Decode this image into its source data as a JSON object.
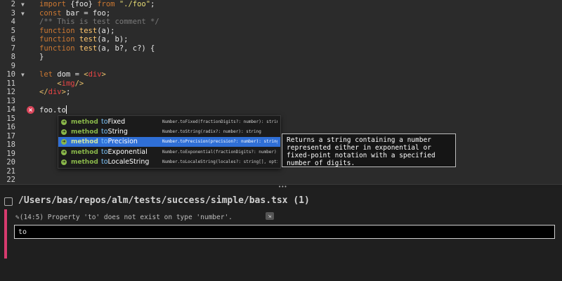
{
  "editor": {
    "lines": [
      {
        "num": "2",
        "html": "<span class='kw'>import</span> {foo} <span class='kw'>from</span> <span class='str'>\"./foo\"</span>;"
      },
      {
        "num": "3",
        "html": "<span class='kw'>const</span> bar = foo;"
      },
      {
        "num": "4",
        "html": "<span class='cmt'>/** This is test comment */</span>"
      },
      {
        "num": "5",
        "html": "<span class='kw'>function</span> <span class='fn'>test</span>(a);"
      },
      {
        "num": "6",
        "html": "<span class='kw'>function</span> <span class='fn'>test</span>(a, b);"
      },
      {
        "num": "7",
        "html": "<span class='kw'>function</span> <span class='fn'>test</span>(a, b?, c?) {"
      },
      {
        "num": "8",
        "html": "}"
      },
      {
        "num": "9",
        "html": ""
      },
      {
        "num": "10",
        "html": "<span class='kw'>let</span> dom = <span class='tag'>&lt;</span><span class='tagname'>div</span><span class='tag'>&gt;</span>"
      },
      {
        "num": "11",
        "html": "    <span class='tag'>&lt;</span><span class='tagname'>img</span><span class='tag'>/&gt;</span>"
      },
      {
        "num": "12",
        "html": "<span class='tag'>&lt;/</span><span class='tagname'>div</span><span class='tag'>&gt;</span>;"
      },
      {
        "num": "13",
        "html": ""
      },
      {
        "num": "14",
        "html": "foo.to<span class='caret'></span>"
      },
      {
        "num": "15",
        "html": ""
      },
      {
        "num": "16",
        "html": ""
      },
      {
        "num": "17",
        "html": ""
      },
      {
        "num": "18",
        "html": ""
      },
      {
        "num": "19",
        "html": ""
      },
      {
        "num": "20",
        "html": ""
      },
      {
        "num": "21",
        "html": ""
      },
      {
        "num": "22",
        "html": ""
      }
    ],
    "fold_lines": [
      "2",
      "3",
      "10"
    ],
    "error_line": "14"
  },
  "autocomplete": {
    "items": [
      {
        "kind": "method",
        "name_match": "to",
        "name_rest": "Fixed",
        "signature": "Number.toFixed(fractionDigits?: number): string",
        "selected": false
      },
      {
        "kind": "method",
        "name_match": "to",
        "name_rest": "String",
        "signature": "Number.toString(radix?: number): string",
        "selected": false
      },
      {
        "kind": "method",
        "name_match": "to",
        "name_rest": "Precision",
        "signature": "Number.toPrecision(precision?: number): string",
        "selected": true
      },
      {
        "kind": "method",
        "name_match": "to",
        "name_rest": "Exponential",
        "signature": "Number.toExponential(fractionDigits?: number): string",
        "selected": false
      },
      {
        "kind": "method",
        "name_match": "to",
        "name_rest": "LocaleString",
        "signature": "Number.toLocaleString(locales?: string[], options?: any): string",
        "selected": false
      }
    ],
    "doc": "Returns a string containing a number represented either in exponential or fixed-point notation with a specified number of digits."
  },
  "panel": {
    "file_path": "/Users/bas/repos/alm/tests/success/simple/bas.tsx (1)",
    "error_position": "(14:5)",
    "error_message": "Property 'to' does not exist on type 'number'.",
    "command_value": "to"
  },
  "splitter": {
    "grip": "•••"
  },
  "icons": {
    "error": "error-icon",
    "fold": "fold-arrow-icon",
    "method": "method-icon",
    "file": "file-icon",
    "goto": "goto-icon"
  },
  "colors": {
    "background": "#2b2b2b",
    "keyword": "#cc7832",
    "string": "#e6db74",
    "selection": "#2f6fd6",
    "error": "#d63b6e"
  }
}
